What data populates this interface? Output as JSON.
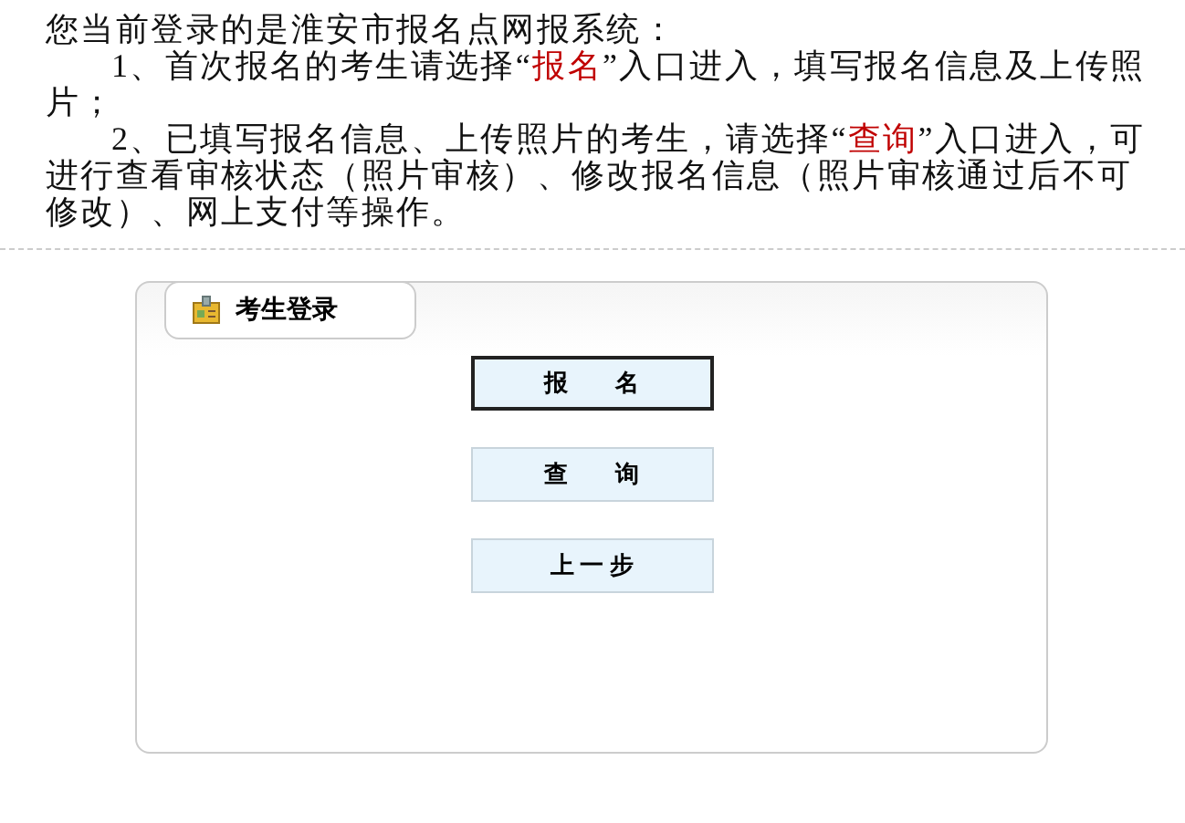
{
  "intro": "您当前登录的是淮安市报名点网报系统：",
  "paragraphs": [
    [
      {
        "text": "1、首次报名的考生请选择“",
        "highlight": false
      },
      {
        "text": "报名",
        "highlight": true
      },
      {
        "text": "”入口进入，填写报名信息及上传照片；",
        "highlight": false
      }
    ],
    [
      {
        "text": "2、已填写报名信息、上传照片的考生，请选择“",
        "highlight": false
      },
      {
        "text": "查询",
        "highlight": true
      },
      {
        "text": "”入口进入，可进行查看审核状态（照片审核）、修改报名信息（照片审核通过后不可修改）、网上支付等操作。",
        "highlight": false
      }
    ]
  ],
  "panel": {
    "title": "考生登录",
    "buttons": [
      {
        "label": "报　　名",
        "focused": true
      },
      {
        "label": "查　　询",
        "focused": false
      },
      {
        "label": "上 一 步",
        "focused": false
      }
    ]
  }
}
